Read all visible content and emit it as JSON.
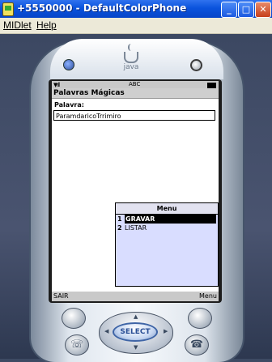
{
  "window": {
    "title": "+5550000 - DefaultColorPhone",
    "minimize": "_",
    "maximize": "□",
    "close": "✕"
  },
  "menubar": {
    "items": [
      "MIDlet",
      "Help"
    ]
  },
  "screen": {
    "status": {
      "input_mode": "ABC",
      "signal_icon": "signal-bars-icon",
      "battery_icon": "battery-icon"
    },
    "form_title": "Palavras Mágicas",
    "field_label": "Palavra:",
    "field_value": "ParamdaricoTrrimiro",
    "menu": {
      "title": "Menu",
      "items": [
        {
          "num": "1",
          "label": "GRAVAR",
          "selected": true
        },
        {
          "num": "2",
          "label": "LISTAR",
          "selected": false
        }
      ]
    },
    "soft_left": "SAIR",
    "soft_right": "Menu"
  },
  "keys": {
    "select_label": "SELECT",
    "call_glyph": "☏",
    "end_glyph": "☎"
  },
  "colors": {
    "title_bar": "#0a53dd",
    "screen_background": "#ffffff",
    "menu_background": "#d9ddff",
    "selected_item": "#000000",
    "select_key": "#2a4f96"
  }
}
